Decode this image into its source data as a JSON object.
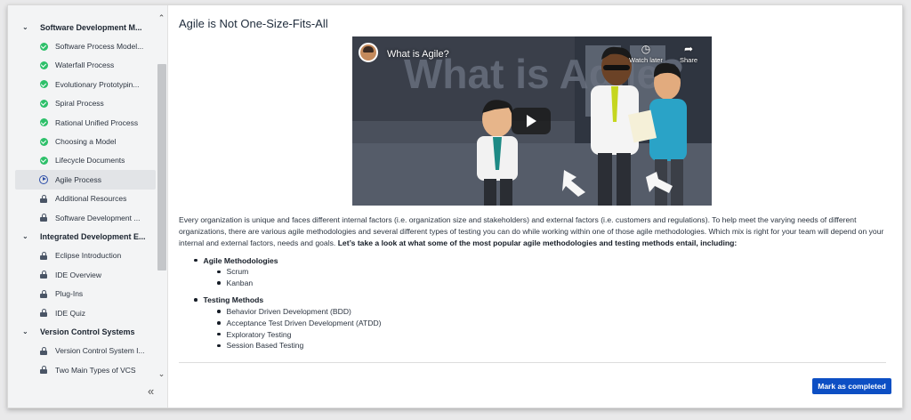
{
  "sidebar": {
    "sections": [
      {
        "title": "Software Development M...",
        "items": [
          {
            "label": "Software Process Model...",
            "status": "completed"
          },
          {
            "label": "Waterfall Process",
            "status": "completed"
          },
          {
            "label": "Evolutionary Prototypin...",
            "status": "completed"
          },
          {
            "label": "Spiral Process",
            "status": "completed"
          },
          {
            "label": "Rational Unified Process",
            "status": "completed"
          },
          {
            "label": "Choosing a Model",
            "status": "completed"
          },
          {
            "label": "Lifecycle Documents",
            "status": "completed"
          },
          {
            "label": "Agile Process",
            "status": "current"
          },
          {
            "label": "Additional Resources",
            "status": "locked"
          },
          {
            "label": "Software Development ...",
            "status": "locked"
          }
        ]
      },
      {
        "title": "Integrated Development E...",
        "items": [
          {
            "label": "Eclipse Introduction",
            "status": "locked"
          },
          {
            "label": "IDE Overview",
            "status": "locked"
          },
          {
            "label": "Plug-Ins",
            "status": "locked"
          },
          {
            "label": "IDE Quiz",
            "status": "locked"
          }
        ]
      },
      {
        "title": "Version Control Systems",
        "items": [
          {
            "label": "Version Control System I...",
            "status": "locked"
          },
          {
            "label": "Two Main Types of VCS",
            "status": "locked"
          }
        ]
      }
    ],
    "collapse_glyph": "«",
    "colors": {
      "completed": "#2ec06a",
      "current": "#2c4ea8",
      "locked": "#4a5566"
    }
  },
  "lesson": {
    "title": "Agile is Not One-Size-Fits-All",
    "video": {
      "title": "What is Agile?",
      "watch_later_label": "Watch later",
      "share_label": "Share"
    },
    "intro": "Every organization is unique and faces different internal factors (i.e. organization size and stakeholders) and external factors (i.e. customers and regulations). To help meet the varying needs of different organizations, there are various agile methodologies and several different types of testing you can do while working within one of those agile methodologies. Which mix is right for your team will depend on your internal and external factors, needs and goals. ",
    "intro_bold": "Let’s take a look at what some of the most popular agile methodologies and testing methods entail, including:",
    "lists": [
      {
        "heading": "Agile Methodologies",
        "items": [
          "Scrum",
          "Kanban"
        ]
      },
      {
        "heading": "Testing Methods",
        "items": [
          "Behavior Driven Development (BDD)",
          "Acceptance Test Driven Development (ATDD)",
          "Exploratory Testing",
          "Session Based Testing"
        ]
      }
    ],
    "complete_button": "Mark as completed",
    "accent": "#0d4fc4"
  }
}
